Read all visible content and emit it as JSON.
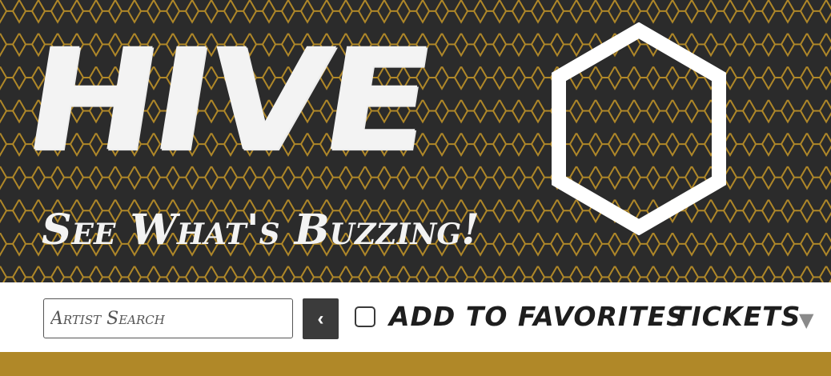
{
  "banner": {
    "title": "HIVE",
    "tagline": "See What's Buzzing!",
    "logo_icon": "hexagon-icon",
    "pattern_color": "#b08828",
    "background_color": "#2b2b2b"
  },
  "toolbar": {
    "search": {
      "placeholder": "Artist Search",
      "value": ""
    },
    "back_button": {
      "icon": "chevron-left-icon",
      "glyph": "‹"
    },
    "favorites": {
      "label": "ADD TO FAVORITES",
      "checked": false
    },
    "tickets": {
      "label": "TICKETS",
      "arrow": "▼"
    }
  },
  "accent_color": "#b08828"
}
